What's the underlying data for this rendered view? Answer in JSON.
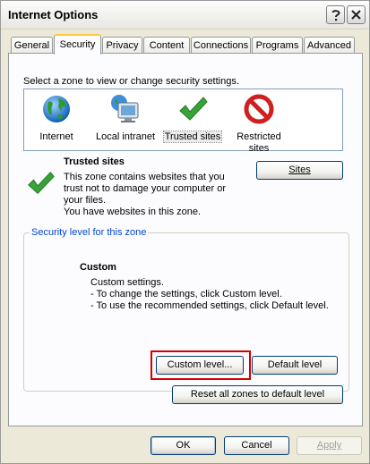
{
  "window": {
    "title": "Internet Options",
    "controls": {
      "help_icon": "help-icon",
      "close_icon": "close-icon"
    }
  },
  "tabs": [
    {
      "label": "General"
    },
    {
      "label": "Security",
      "active": true
    },
    {
      "label": "Privacy"
    },
    {
      "label": "Content"
    },
    {
      "label": "Connections"
    },
    {
      "label": "Programs"
    },
    {
      "label": "Advanced"
    }
  ],
  "security": {
    "zone_prompt": "Select a zone to view or change security settings.",
    "zones": [
      {
        "label": "Internet",
        "icon": "globe-icon"
      },
      {
        "label": "Local intranet",
        "icon": "monitor-icon"
      },
      {
        "label": "Trusted sites",
        "icon": "checkmark-icon",
        "selected": true
      },
      {
        "label_line1": "Restricted",
        "label_line2": "sites",
        "icon": "restricted-icon"
      }
    ],
    "selected_zone": {
      "name": "Trusted sites",
      "desc_line1": "This zone contains websites that you",
      "desc_line2": "trust not to damage your computer or",
      "desc_line3": "your files.",
      "desc_line4": "You have websites in this zone.",
      "sites_button": "Sites"
    },
    "level_group": {
      "caption": "Security level for this zone",
      "level_name": "Custom",
      "line1": "Custom settings.",
      "line2": "- To change the settings, click Custom level.",
      "line3": "- To use the recommended settings, click Default level.",
      "custom_level_button": "Custom level...",
      "default_level_button": "Default level"
    },
    "reset_all_button": "Reset all zones to default level"
  },
  "footer": {
    "ok": "OK",
    "cancel": "Cancel",
    "apply": "Apply"
  },
  "colors": {
    "dialog_bg": "#ece9d8",
    "panel_bg": "#fcfcfe",
    "group_caption": "#0046d5",
    "highlight_border": "#d40000",
    "active_tab_accent": "#ffc83c"
  }
}
